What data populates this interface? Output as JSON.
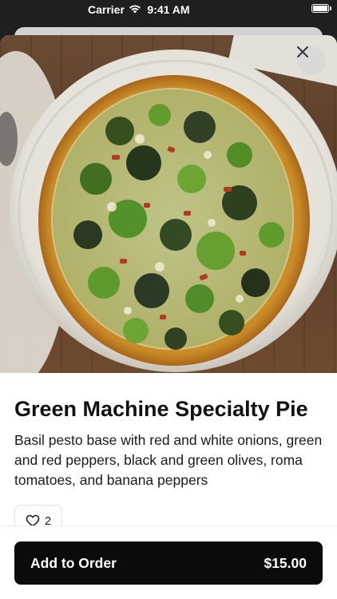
{
  "status_bar": {
    "carrier": "Carrier",
    "time": "9:41 AM",
    "icons": [
      "wifi-icon",
      "battery-icon"
    ]
  },
  "item": {
    "title": "Green Machine Specialty Pie",
    "description": "Basil pesto base with red and white onions, green and red peppers, black and green olives, roma tomatoes, and banana peppers",
    "likes": "2",
    "image": "pizza-photo"
  },
  "close_button": {
    "icon": "close-icon"
  },
  "order_button": {
    "label": "Add to Order",
    "price": "$15.00"
  },
  "colors": {
    "button_bg": "#0b0b0b",
    "text": "#111111",
    "background": "#ffffff"
  }
}
